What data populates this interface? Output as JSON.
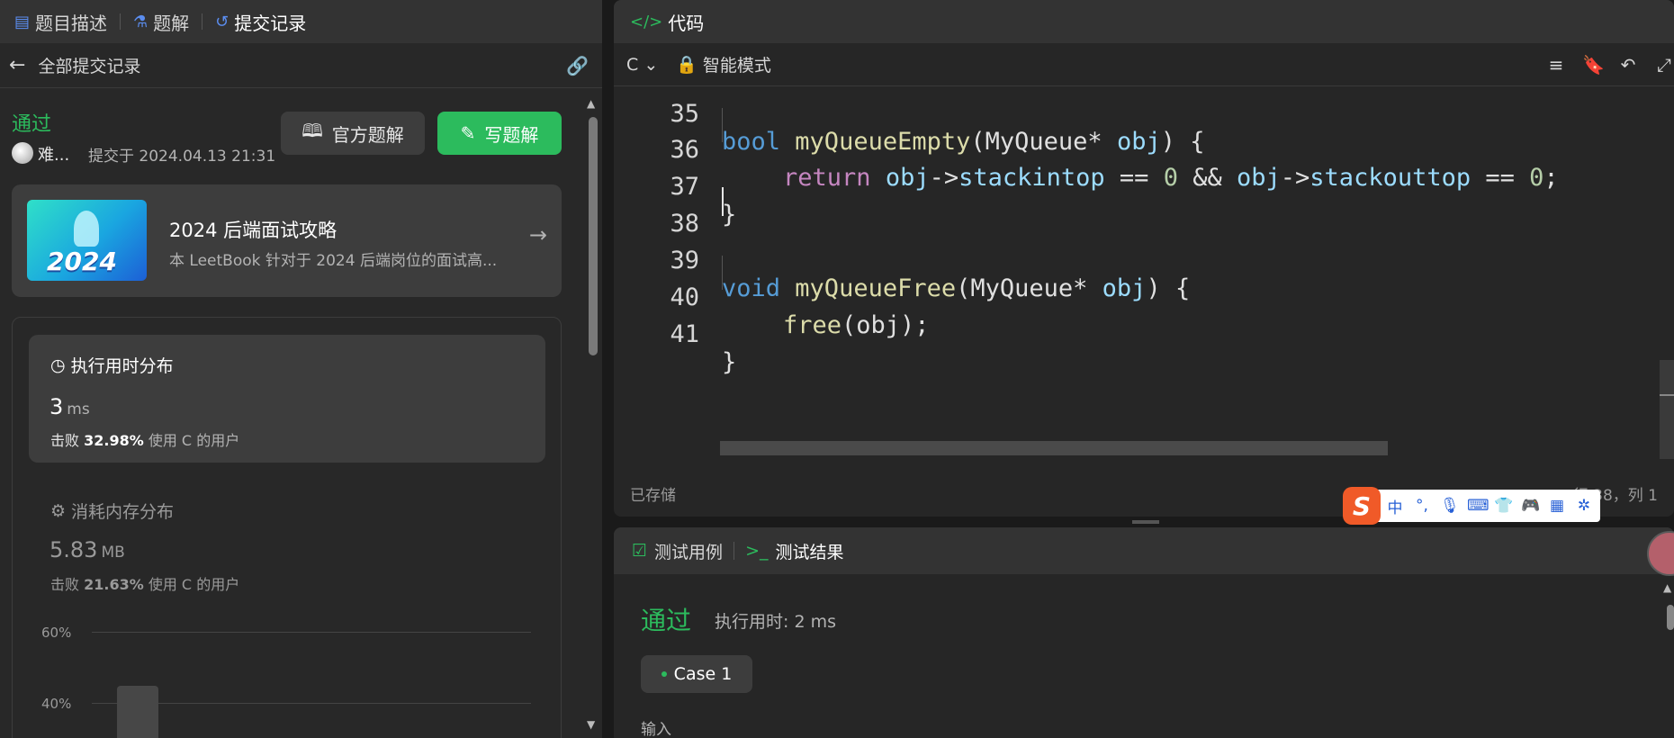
{
  "left_tabs": [
    {
      "label": "题目描述",
      "icon": "doc-icon"
    },
    {
      "label": "题解",
      "icon": "flask-icon"
    },
    {
      "label": "提交记录",
      "icon": "history-icon"
    }
  ],
  "subheader": {
    "back_label": "全部提交记录",
    "link_icon": "link-icon"
  },
  "submission": {
    "status": "通过",
    "user": "难...",
    "submitted_at": "提交于 2024.04.13 21:31",
    "official_solution_label": "官方题解",
    "write_solution_label": "写题解"
  },
  "book_card": {
    "year_badge": "2024",
    "title": "2024 后端面试攻略",
    "desc": "本 LeetBook 针对于 2024 后端岗位的面试高..."
  },
  "runtime": {
    "title": "执行用时分布",
    "value": "3",
    "unit": "ms",
    "beat_prefix": "击败",
    "beat_pct": "32.98%",
    "beat_suffix": "使用 C 的用户"
  },
  "memory": {
    "title": "消耗内存分布",
    "value": "5.83",
    "unit": "MB",
    "beat_prefix": "击败",
    "beat_pct": "21.63%",
    "beat_suffix": "使用 C 的用户"
  },
  "chart_axis": {
    "label_60": "60%",
    "label_40": "40%"
  },
  "code_header": {
    "title": "代码",
    "lang": "C",
    "mode": "智能模式"
  },
  "code_lines": [
    {
      "num": "35",
      "text": "bool myQueueEmpty(MyQueue* obj) {"
    },
    {
      "num": "36",
      "text": "return obj->stackintop == 0 && obj->stackouttop == 0;"
    },
    {
      "num": "37",
      "text": "}"
    },
    {
      "num": "38",
      "text": ""
    },
    {
      "num": "39",
      "text": "void myQueueFree(MyQueue* obj) {"
    },
    {
      "num": "40",
      "text": "free(obj);"
    },
    {
      "num": "41",
      "text": "}"
    }
  ],
  "editor_status": {
    "saved": "已存储",
    "position": "行 38，列 1"
  },
  "ime": {
    "logo": "S",
    "lang": "中",
    "punct": "°,"
  },
  "test_tabs": {
    "cases": "测试用例",
    "results": "测试结果"
  },
  "result": {
    "status": "通过",
    "exec_time": "执行用时: 2 ms",
    "case_label": "Case 1",
    "input_label": "输入"
  },
  "colors": {
    "accent_green": "#2cbb5d",
    "bg": "#262626",
    "panel": "#333333"
  }
}
